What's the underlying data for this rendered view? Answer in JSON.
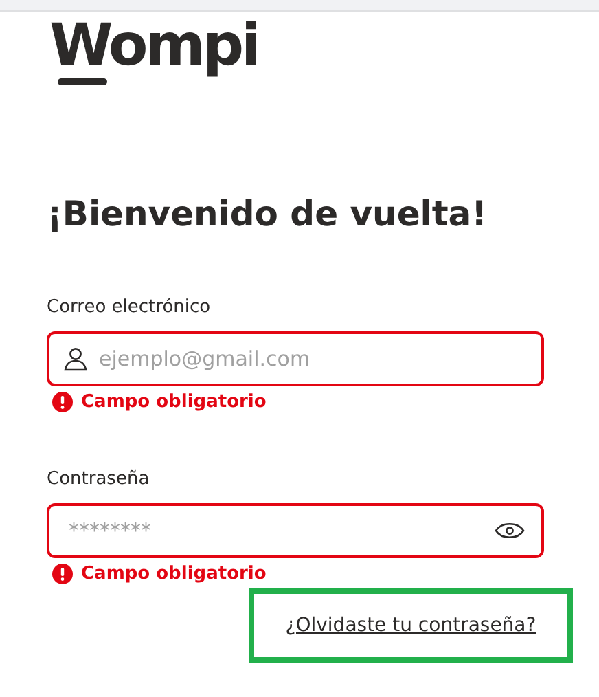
{
  "logo": {
    "text": "Wompi"
  },
  "heading": "¡Bienvenido de vuelta!",
  "fields": [
    {
      "kind": "email",
      "label": "Correo electrónico",
      "placeholder": "ejemplo@gmail.com",
      "error": true,
      "error_text": "Campo obligatorio"
    },
    {
      "kind": "password",
      "label": "Contraseña",
      "placeholder": "********",
      "error": true,
      "error_text": "Campo obligatorio"
    }
  ],
  "forgot_link": {
    "text": "¿Olvidaste tu contraseña?",
    "highlighted": true
  }
}
